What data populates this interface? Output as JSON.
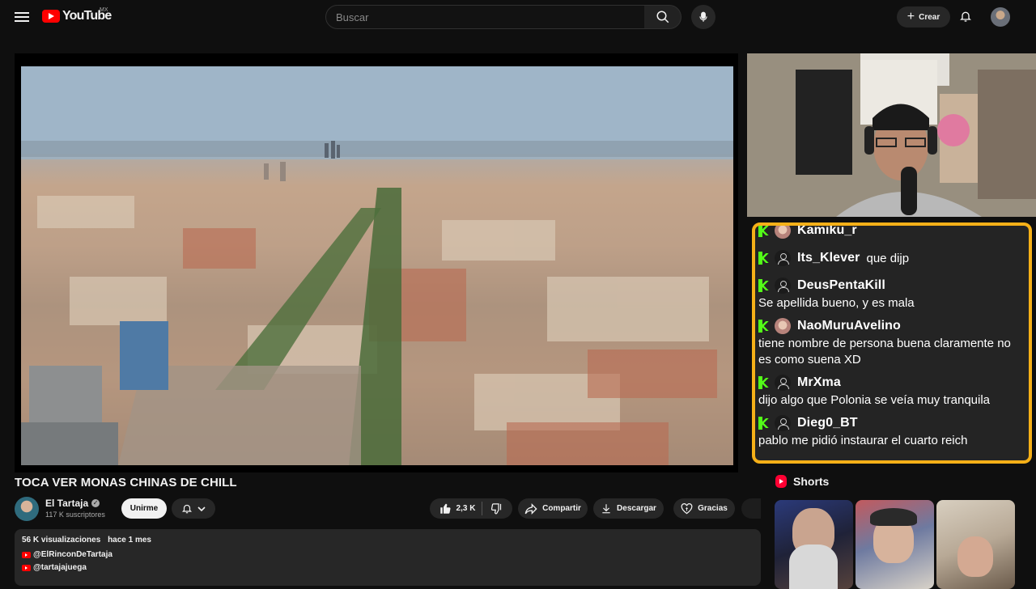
{
  "header": {
    "logo_text": "YouTube",
    "country_code": "MX",
    "search_placeholder": "Buscar",
    "create_label": "Crear"
  },
  "chat": {
    "messages": [
      {
        "user": "Kamiku_r",
        "text": "",
        "avatar": "photo"
      },
      {
        "user": "Its_Klever",
        "text": "que dijp",
        "avatar": "default"
      },
      {
        "user": "DeusPentaKill",
        "text": "Se apellida bueno, y es mala",
        "avatar": "default"
      },
      {
        "user": "NaoMuruAvelino",
        "text": "tiene nombre de persona buena claramente no es como suena XD",
        "avatar": "photo"
      },
      {
        "user": "MrXma",
        "text": "dijo algo que Polonia se veía muy tranquila",
        "avatar": "default"
      },
      {
        "user": "Dieg0_BT",
        "text": "pablo me pidió instaurar el cuarto reich",
        "avatar": "default"
      }
    ]
  },
  "video": {
    "title": "TOCA VER MONAS CHINAS DE CHILL",
    "channel_name": "El Tartaja",
    "subscribers": "117 K suscriptores",
    "join_label": "Unirme",
    "likes": "2,3 K",
    "share_label": "Compartir",
    "download_label": "Descargar",
    "thanks_label": "Gracias"
  },
  "description": {
    "views": "56 K visualizaciones",
    "date": "hace 1 mes",
    "links": [
      "@ElRinconDeTartaja",
      "@tartajajuega"
    ]
  },
  "shorts": {
    "heading": "Shorts"
  },
  "colors": {
    "youtube_red": "#ff0000",
    "chat_border": "#f5b018",
    "kick_green": "#53fc18",
    "background": "#0f0f0f"
  }
}
